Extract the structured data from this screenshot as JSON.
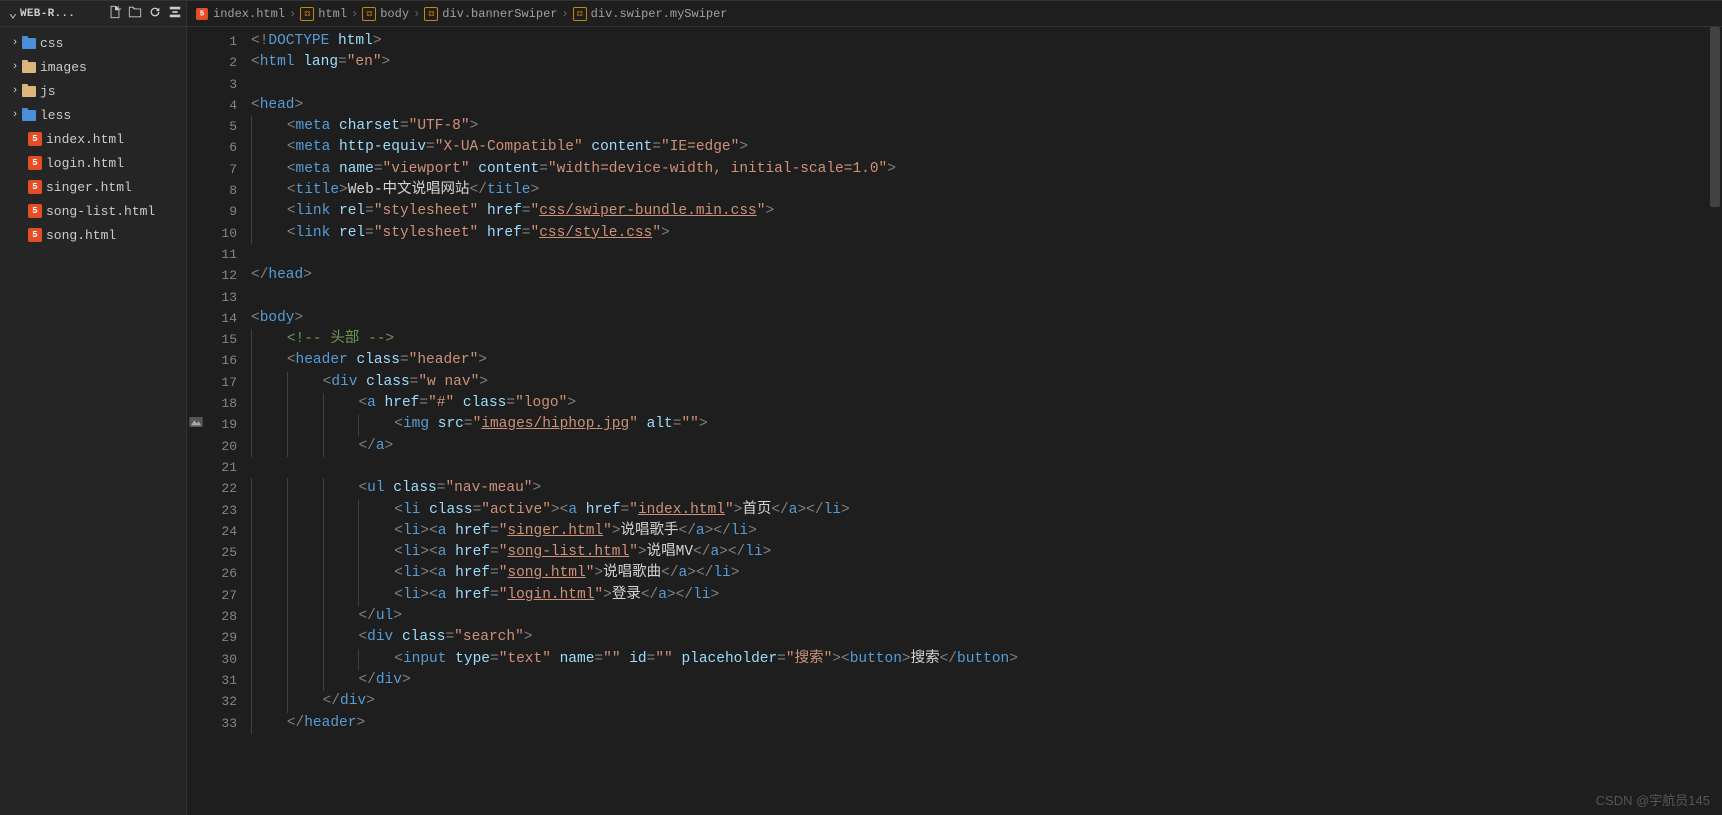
{
  "sidebar": {
    "project": "WEB-R...",
    "folders": [
      {
        "label": "css",
        "icon": "blue"
      },
      {
        "label": "images",
        "icon": "yellow"
      },
      {
        "label": "js",
        "icon": "yellow"
      },
      {
        "label": "less",
        "icon": "blue"
      }
    ],
    "files": [
      {
        "label": "index.html"
      },
      {
        "label": "login.html"
      },
      {
        "label": "singer.html"
      },
      {
        "label": "song-list.html"
      },
      {
        "label": "song.html"
      }
    ]
  },
  "breadcrumbs": [
    {
      "kind": "file",
      "label": "index.html"
    },
    {
      "kind": "tag",
      "label": "html"
    },
    {
      "kind": "tag",
      "label": "body"
    },
    {
      "kind": "tag",
      "label": "div.bannerSwiper"
    },
    {
      "kind": "tag",
      "label": "div.swiper.mySwiper"
    }
  ],
  "code_text": {
    "title": "Web-中文说唱网站",
    "nav_home": "首页",
    "nav_singer": "说唱歌手",
    "nav_mv": "说唱MV",
    "nav_song": "说唱歌曲",
    "nav_login": "登录",
    "placeholder": "搜索",
    "btn": "搜索",
    "cmt_head": "<!-- 头部 -->"
  },
  "line_count": 33,
  "watermark": "CSDN @宇航员145"
}
